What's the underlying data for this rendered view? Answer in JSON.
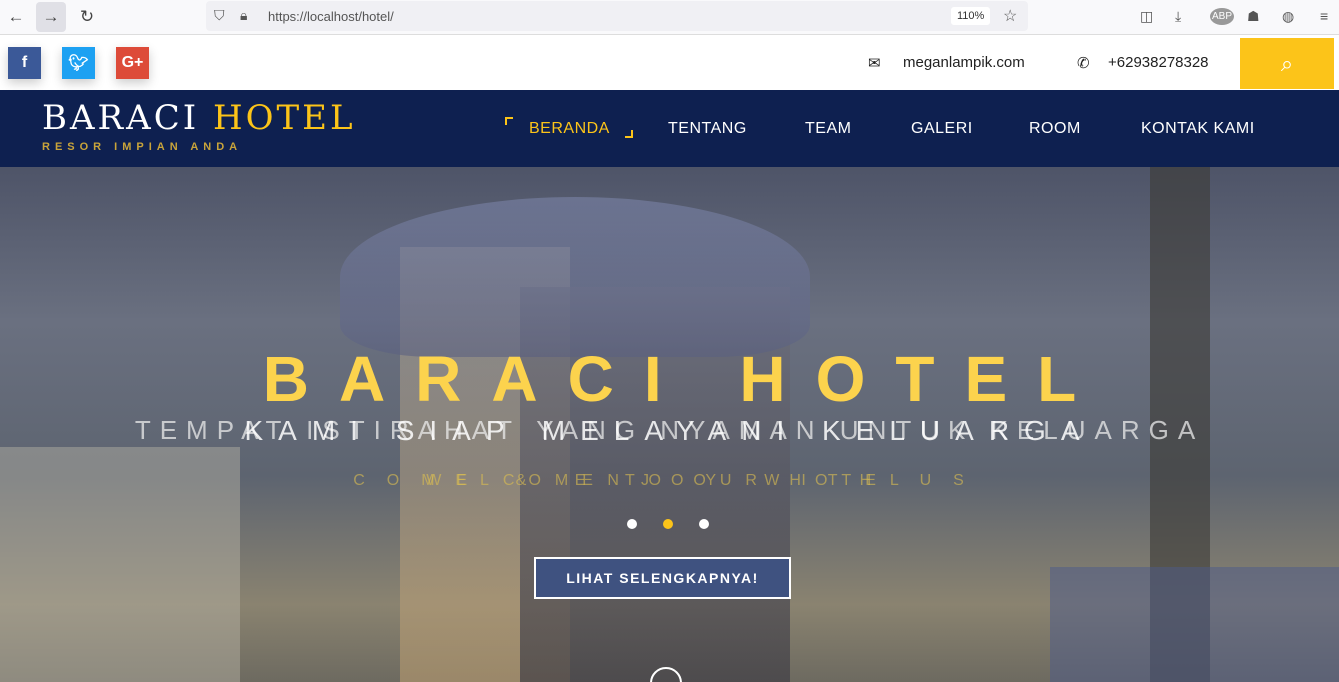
{
  "browser": {
    "url": "https://localhost/hotel/",
    "zoom": "110%"
  },
  "topbar": {
    "social": [
      {
        "name": "facebook",
        "glyph": "f",
        "color": "#3b5998"
      },
      {
        "name": "twitter",
        "glyph": "t",
        "color": "#1da1f2"
      },
      {
        "name": "google-plus",
        "glyph": "G+",
        "color": "#dd4b39"
      }
    ],
    "email": "meganlampik.com",
    "phone": "+62938278328"
  },
  "nav": {
    "logo_main": "BARACI",
    "logo_accent": "HOTEL",
    "tagline": "RESOR IMPIAN ANDA",
    "items": [
      "BERANDA",
      "TENTANG",
      "TEAM",
      "GALERI",
      "ROOM",
      "KONTAK KAMI"
    ]
  },
  "hero": {
    "title": "BARACI HOTEL",
    "subtitle_a": "TEMPAT ISTIRAHAT YANG NYAMAN UNTUK KELUARGA",
    "subtitle_b": "KAMI SIAP MELAYANI KELUARGA",
    "tagline_a": "COME & ENJOY WITH US",
    "tagline_b": "WELCOME TO OUR HOTEL",
    "cta": "LIHAT SELENGKAPNYA!",
    "slides": 3,
    "active_slide": 2
  },
  "colors": {
    "accent": "#fcc419",
    "navy": "#0e2050"
  }
}
